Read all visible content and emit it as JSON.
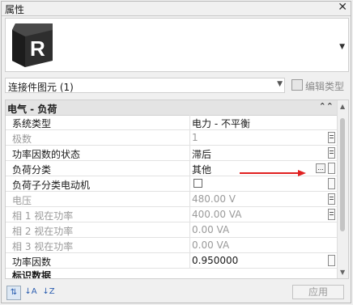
{
  "window": {
    "title": "属性",
    "close_glyph": "✕"
  },
  "preview": {
    "logo_letter": "R",
    "logo_icon": "revit-logo-icon"
  },
  "type_selector": {
    "label": "连接件图元 (1)",
    "edit_type_label": "编辑类型"
  },
  "group": {
    "label": "电气 - 负荷",
    "collapse_glyph": "⌃⌃"
  },
  "rows": [
    {
      "name": "系统类型",
      "value": "电力 - 不平衡",
      "disabled": false
    },
    {
      "name": "极数",
      "value": "1",
      "disabled": true
    },
    {
      "name": "功率因数的状态",
      "value": "滞后",
      "disabled": false
    },
    {
      "name": "负荷分类",
      "value": "其他",
      "disabled": false,
      "browse_label": "..."
    },
    {
      "name": "负荷子分类电动机",
      "value": "",
      "disabled": false,
      "checkbox": true
    },
    {
      "name": "电压",
      "value": "480.00 V",
      "disabled": true
    },
    {
      "name": "相 1 视在功率",
      "value": "400.00 VA",
      "disabled": true
    },
    {
      "name": "相 2 视在功率",
      "value": "0.00 VA",
      "disabled": true
    },
    {
      "name": "相 3 视在功率",
      "value": "0.00 VA",
      "disabled": true
    },
    {
      "name": "功率因数",
      "value": "0.950000",
      "disabled": false
    }
  ],
  "cut_row_label": "标识数据",
  "bottom": {
    "apply_label": "应用"
  },
  "colors": {
    "annotation_arrow": "#e02020",
    "logo_bg": "#3a3a3a"
  }
}
